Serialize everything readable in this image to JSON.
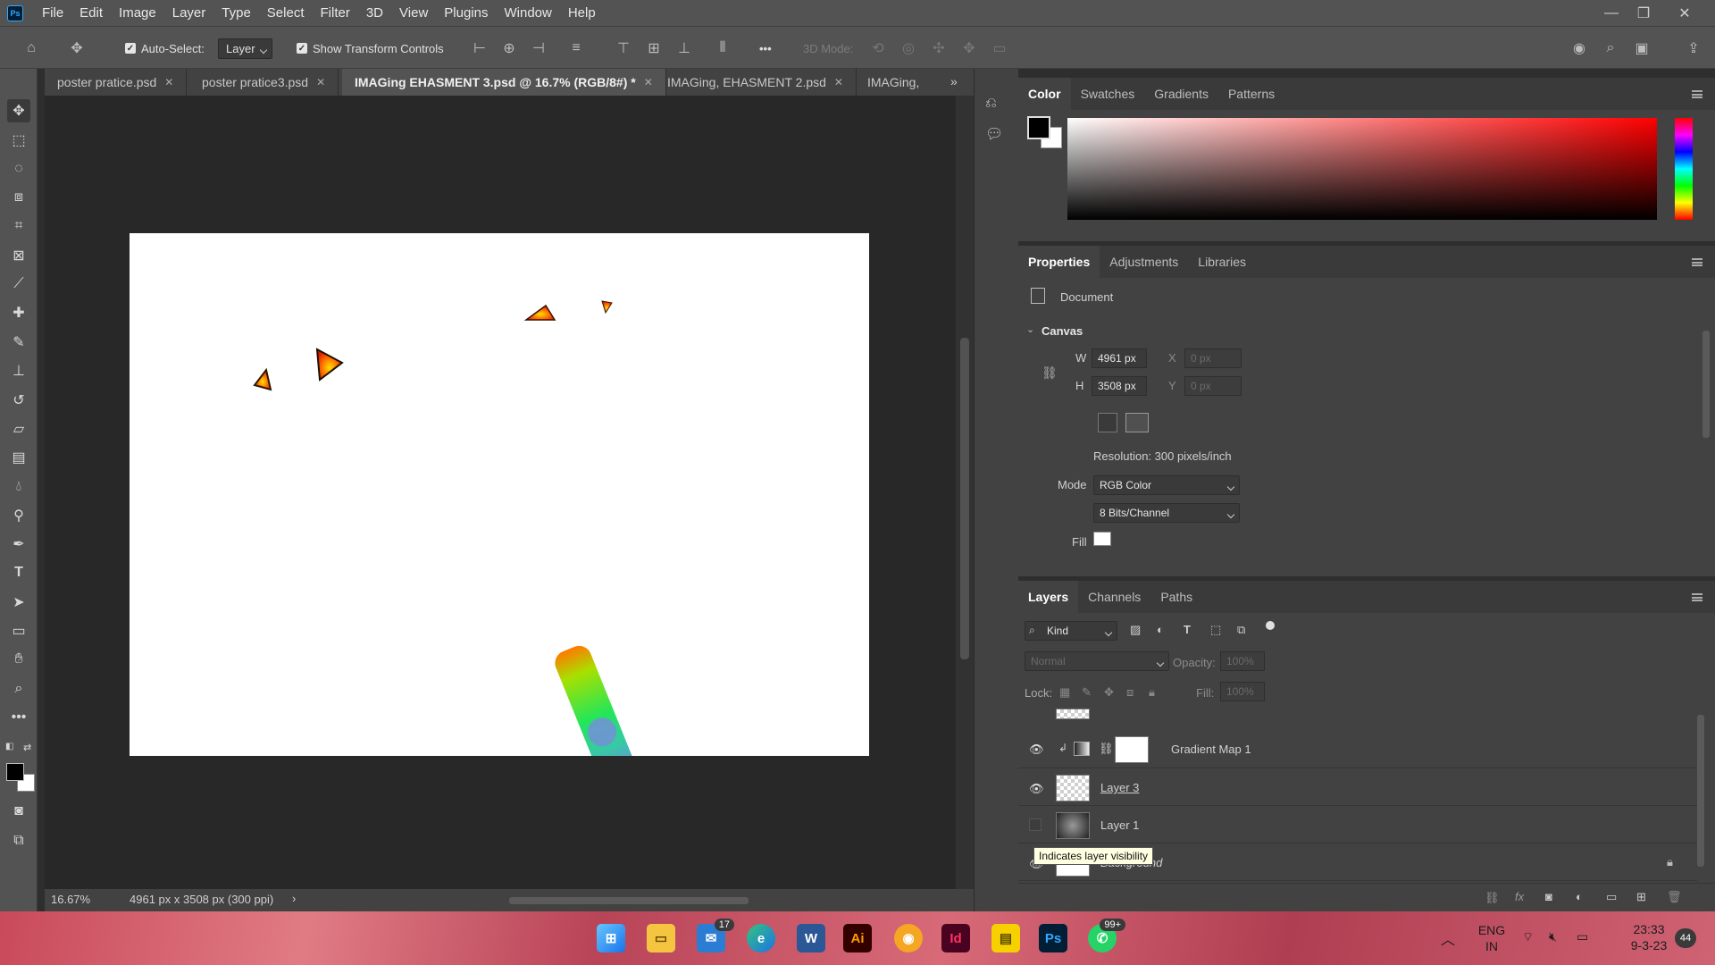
{
  "menubar": {
    "logo": "Ps",
    "items": [
      "File",
      "Edit",
      "Image",
      "Layer",
      "Type",
      "Select",
      "Filter",
      "3D",
      "View",
      "Plugins",
      "Window",
      "Help"
    ]
  },
  "options": {
    "auto_select_label": "Auto-Select:",
    "auto_select_value": "Layer",
    "transform_controls_label": "Show Transform Controls",
    "more": "•••",
    "mode_3d_label": "3D Mode:"
  },
  "tabs": [
    {
      "label": "poster pratice.psd",
      "active": false
    },
    {
      "label": "poster pratice3.psd",
      "active": false
    },
    {
      "label": "IMAGing EHASMENT 3.psd @ 16.7% (RGB/8#) *",
      "active": true
    },
    {
      "label": "IMAGing, EHASMENT 2.psd",
      "active": false
    },
    {
      "label": "IMAGing,",
      "active": false
    }
  ],
  "tab_overflow": "»",
  "status": {
    "zoom": "16.67%",
    "doc_info": "4961 px x 3508 px (300 ppi)",
    "arrow": "›"
  },
  "color_panel": {
    "tabs": [
      "Color",
      "Swatches",
      "Gradients",
      "Patterns"
    ],
    "fg": "#000000",
    "bg": "#ffffff",
    "hue": "#ff0000"
  },
  "properties": {
    "tabs": [
      "Properties",
      "Adjustments",
      "Libraries"
    ],
    "doc_label": "Document",
    "section": "Canvas",
    "w_label": "W",
    "w_value": "4961 px",
    "h_label": "H",
    "h_value": "3508 px",
    "x_label": "X",
    "x_value": "0 px",
    "y_label": "Y",
    "y_value": "0 px",
    "resolution": "Resolution: 300 pixels/inch",
    "mode_label": "Mode",
    "mode_value": "RGB Color",
    "bits_value": "8 Bits/Channel",
    "fill_label": "Fill"
  },
  "layers_panel": {
    "tabs": [
      "Layers",
      "Channels",
      "Paths"
    ],
    "filter_label": "Kind",
    "blend_mode": "Normal",
    "opacity_label": "Opacity:",
    "opacity_value": "100%",
    "lock_label": "Lock:",
    "fill_label": "Fill:",
    "fill_value": "100%",
    "layers": [
      {
        "name": "Gradient Map 1",
        "visible": true
      },
      {
        "name": "Layer 3",
        "visible": true
      },
      {
        "name": "Layer 1",
        "visible": false
      },
      {
        "name": "Background",
        "visible": true
      }
    ],
    "tooltip": "Indicates layer visibility"
  },
  "taskbar": {
    "mail_badge": "17",
    "whatsapp_badge": "99+",
    "ai_label": "Ai",
    "id_label": "Id",
    "ps_label": "Ps",
    "word_label": "W",
    "lang": "ENG",
    "region": "IN",
    "time": "23:33",
    "date": "9-3-23",
    "notif_count": "44"
  }
}
